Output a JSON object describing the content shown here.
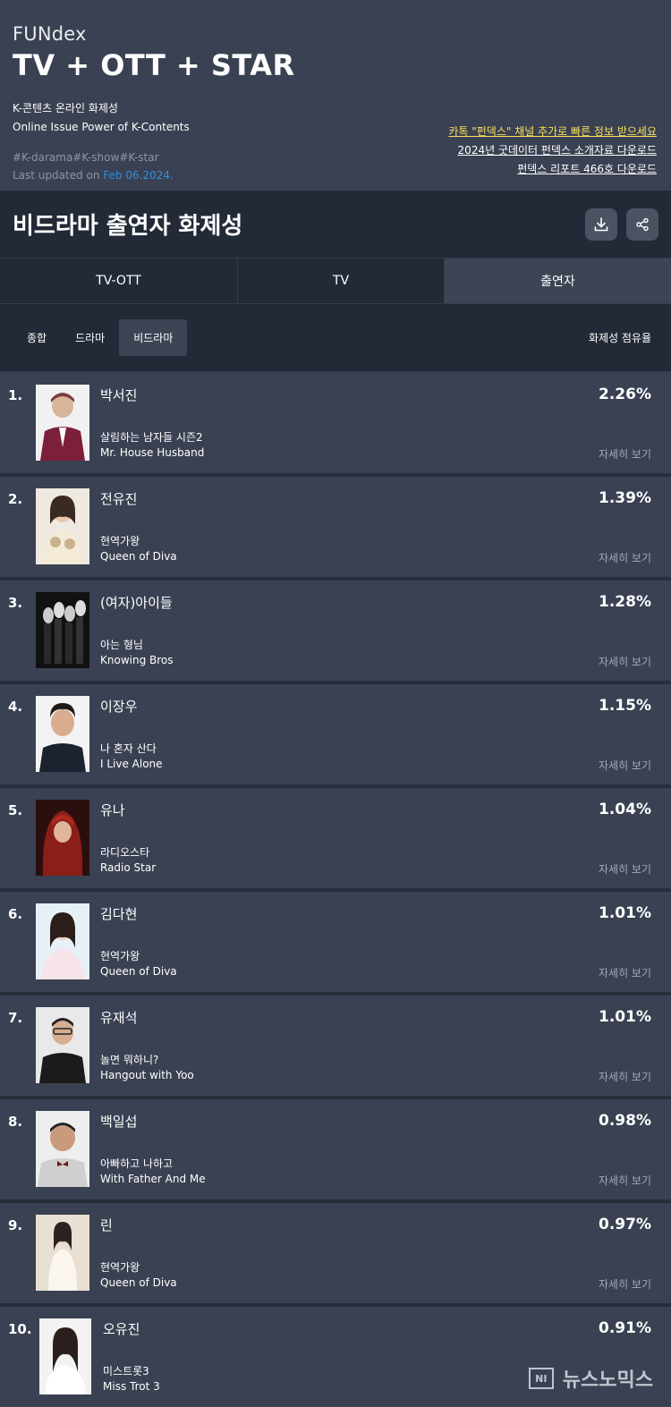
{
  "header": {
    "brand": "FUNdex",
    "title": "TV + OTT + STAR",
    "subtitle_ko": "K-콘텐츠 온라인 화제성",
    "subtitle_en": "Online Issue Power of K-Contents",
    "hashtags": "#K-darama#K-show#K-star",
    "updated_prefix": "Last updated on ",
    "updated_date": "Feb 06.2024.",
    "links": [
      "카톡 \"펀덱스\" 채널 추가로 빠른 정보 받으세요",
      "2024년 굿데이터 펀덱스 소개자료 다운로드",
      "펀덱스 리포트 466호 다운로드"
    ],
    "accent_color": "#2f8fe0",
    "link_highlight_color": "#f7e05c"
  },
  "section": {
    "title": "비드라마 출연자 화제성",
    "download_icon": "download-icon",
    "share_icon": "share-icon"
  },
  "tabs": [
    {
      "label": "TV-OTT",
      "active": false
    },
    {
      "label": "TV",
      "active": false
    },
    {
      "label": "출연자",
      "active": true
    }
  ],
  "subtabs": [
    {
      "label": "종합",
      "active": false
    },
    {
      "label": "드라마",
      "active": false
    },
    {
      "label": "비드라마",
      "active": true
    }
  ],
  "share_label": "화제성 점유율",
  "detail_label": "자세히 보기",
  "rankings": [
    {
      "rank": "1.",
      "name": "박서진",
      "show_ko": "살림하는 남자들 시즌2",
      "show_en": "Mr. House Husband",
      "share": "2.26%"
    },
    {
      "rank": "2.",
      "name": "전유진",
      "show_ko": "현역가왕",
      "show_en": "Queen of Diva",
      "share": "1.39%"
    },
    {
      "rank": "3.",
      "name": "(여자)아이들",
      "show_ko": "아는 형님",
      "show_en": "Knowing Bros",
      "share": "1.28%"
    },
    {
      "rank": "4.",
      "name": "이장우",
      "show_ko": "나 혼자 산다",
      "show_en": "I Live Alone",
      "share": "1.15%"
    },
    {
      "rank": "5.",
      "name": "유나",
      "show_ko": "라디오스타",
      "show_en": "Radio Star",
      "share": "1.04%"
    },
    {
      "rank": "6.",
      "name": "김다현",
      "show_ko": "현역가왕",
      "show_en": "Queen of Diva",
      "share": "1.01%"
    },
    {
      "rank": "7.",
      "name": "유재석",
      "show_ko": "놀면 뭐하니?",
      "show_en": "Hangout with Yoo",
      "share": "1.01%"
    },
    {
      "rank": "8.",
      "name": "백일섭",
      "show_ko": "아빠하고 나하고",
      "show_en": "With Father And Me",
      "share": "0.98%"
    },
    {
      "rank": "9.",
      "name": "린",
      "show_ko": "현역가왕",
      "show_en": "Queen of Diva",
      "share": "0.97%"
    },
    {
      "rank": "10.",
      "name": "오유진",
      "show_ko": "미스트롯3",
      "show_en": "Miss Trot 3",
      "share": "0.91%"
    }
  ],
  "watermark": {
    "logo": "NI",
    "text": "뉴스노믹스"
  }
}
